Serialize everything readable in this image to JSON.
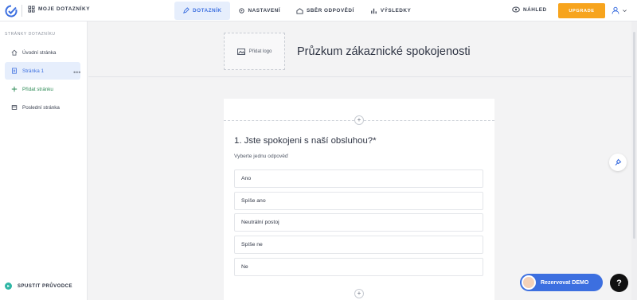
{
  "topbar": {
    "brand_label": "MOJE DOTAZNÍKY",
    "tabs": [
      {
        "label": "DOTAZNÍK",
        "icon": "pencil-icon",
        "active": true
      },
      {
        "label": "NASTAVENÍ",
        "icon": "gear-icon",
        "active": false
      },
      {
        "label": "SBĚR ODPOVĚDÍ",
        "icon": "share-icon",
        "active": false
      },
      {
        "label": "VÝSLEDKY",
        "icon": "chart-icon",
        "active": false
      }
    ],
    "preview_label": "NÁHLED",
    "upgrade_label": "UPGRADE",
    "upgrade_color": "#f7a41d",
    "accent_color": "#3c6fe0"
  },
  "sidebar": {
    "title": "STRÁNKY DOTAZNÍKU",
    "items": [
      {
        "label": "Úvodní stránka",
        "icon": "home-icon"
      },
      {
        "label": "Stránka 1",
        "icon": "page-icon",
        "active": true
      },
      {
        "label": "Přidat stránku",
        "icon": "plus-icon"
      },
      {
        "label": "Poslední stránka",
        "icon": "flag-icon"
      }
    ],
    "more_label": "•••",
    "guide_label": "SPUSTIT PRŮVODCE"
  },
  "survey": {
    "logo_placeholder": "Přidat logo",
    "title": "Průzkum zákaznické spokojenosti",
    "question": {
      "title": "1. Jste spokojeni s naší obsluhou?*",
      "subtitle": "Vyberte jednu odpověď",
      "options": [
        "Ano",
        "Spíše ano",
        "Neutrální postoj",
        "Spíše ne",
        "Ne"
      ]
    }
  },
  "widgets": {
    "demo_label": "Rezervovat DEMO",
    "help_label": "?"
  }
}
